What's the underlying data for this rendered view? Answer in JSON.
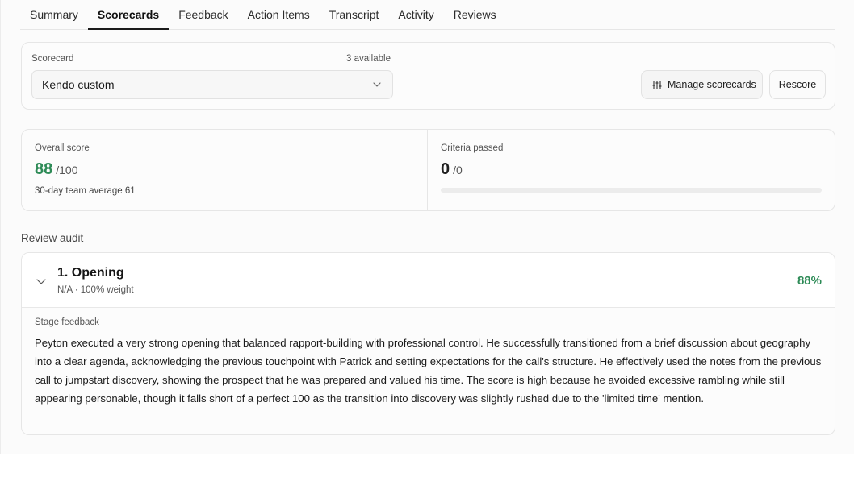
{
  "tabs": [
    {
      "label": "Summary",
      "active": false
    },
    {
      "label": "Scorecards",
      "active": true
    },
    {
      "label": "Feedback",
      "active": false
    },
    {
      "label": "Action Items",
      "active": false
    },
    {
      "label": "Transcript",
      "active": false
    },
    {
      "label": "Activity",
      "active": false
    },
    {
      "label": "Reviews",
      "active": false
    }
  ],
  "scorecard": {
    "label": "Scorecard",
    "available": "3 available",
    "selected": "Kendo custom",
    "manage_label": "Manage scorecards",
    "rescore_label": "Rescore"
  },
  "metrics": {
    "overall": {
      "label": "Overall score",
      "value": "88",
      "max": "/100",
      "team_average": "30-day team average 61"
    },
    "criteria": {
      "label": "Criteria passed",
      "value": "0",
      "max": "/0",
      "progress": 0
    }
  },
  "audit": {
    "title": "Review audit",
    "stages": [
      {
        "name": "1. Opening",
        "meta": "N/A · 100% weight",
        "percent": "88%",
        "feedback_label": "Stage feedback",
        "feedback": "Peyton executed a very strong opening that balanced rapport-building with professional control. He successfully transitioned from a brief discussion about geography into a clear agenda, acknowledging the previous touchpoint with Patrick and setting expectations for the call's structure. He effectively used the notes from the previous call to jumpstart discovery, showing the prospect that he was prepared and valued his time. The score is high because he avoided excessive rambling while still appearing personable, though it falls short of a perfect 100 as the transition into discovery was slightly rushed due to the 'limited time' mention."
      }
    ]
  },
  "colors": {
    "accent_green": "#2e8b57",
    "active_tab_underline": "#1b1b1b",
    "border": "#e6e6e6"
  },
  "icons": {
    "select_chevron": "chevron-down-icon",
    "manage": "sliders-icon",
    "stage_toggle": "chevron-down-icon"
  }
}
